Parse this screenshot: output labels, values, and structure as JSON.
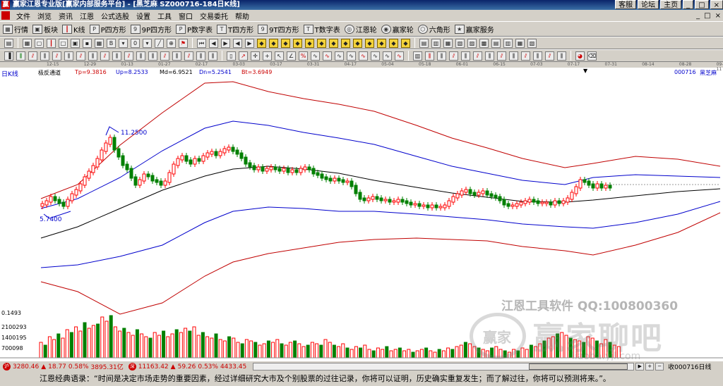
{
  "window": {
    "title": "赢家江恩专业版[赢家内部服务平台] - [黑芝麻   SZ000716-184日K线]",
    "logo_glyph": "赢",
    "buttons": [
      "客服",
      "论坛",
      "主页",
      "_",
      "□",
      "×"
    ]
  },
  "menu": {
    "items": [
      "文件",
      "浏览",
      "资讯",
      "江恩",
      "公式选股",
      "设置",
      "工具",
      "窗口",
      "交易委托",
      "帮助"
    ],
    "right_controls": [
      "_",
      "□",
      "×"
    ]
  },
  "toolbar1": {
    "items": [
      {
        "icon": "grid-icon",
        "label": "行情"
      },
      {
        "icon": "block-icon",
        "label": "板块"
      },
      {
        "icon": "candlestick-icon",
        "label": "K线"
      },
      {
        "icon": "p-square-icon",
        "label": "P四方形"
      },
      {
        "icon": "9p-square-icon",
        "label": "9P四方形"
      },
      {
        "icon": "p-numbers-icon",
        "label": "P数字表"
      },
      {
        "icon": "t-square-icon",
        "label": "T四方形"
      },
      {
        "icon": "9t-square-icon",
        "label": "9T四方形"
      },
      {
        "icon": "t-numbers-icon",
        "label": "T数字表"
      },
      {
        "icon": "gann-wheel-icon",
        "label": "江恩轮"
      },
      {
        "icon": "winner-wheel-icon",
        "label": "赢家轮"
      },
      {
        "icon": "hexagon-icon",
        "label": "六角形"
      },
      {
        "icon": "service-icon",
        "label": "赢家服务"
      }
    ]
  },
  "date_axis": {
    "labels": [
      "12-15",
      "12-29",
      "01-13",
      "01-27",
      "02-17",
      "03-03",
      "03-17",
      "03-31",
      "04-17",
      "05-04",
      "05-18",
      "06-01",
      "06-15",
      "07-03",
      "07-17",
      "07-31",
      "08-14",
      "08-28",
      "09-11"
    ]
  },
  "chart_header": {
    "period_label": "日K线",
    "indicator_name": "极反通道",
    "tp": "Tp=9.3816",
    "up": "Up=8.2533",
    "md": "Md=6.9521",
    "dn": "Dn=5.2541",
    "bt": "Bt=3.6949",
    "stock_code": "000716",
    "stock_name": "黑芝麻"
  },
  "chart_annotations": {
    "high_label": "11.2500",
    "low_label": "5.7400"
  },
  "volume_axis": {
    "labels": [
      "0.1493",
      "2100293",
      "1400195",
      "700098"
    ]
  },
  "watermark": {
    "line1": "江恩工具软件    QQ:100800360",
    "brand_badge": "赢家",
    "brand_big": "赢家聊吧",
    "brand_url": "liaoba.yjl.com"
  },
  "statusbar": {
    "sh_badge": "沪",
    "sh_index": "3280.46",
    "sh_change": "18.77",
    "sh_pct": "0.58%",
    "sh_amount": "3895.31亿",
    "sz_badge": "深",
    "sz_index": "11163.42",
    "sz_change": "59.26",
    "sz_pct": "0.53%",
    "sz_amount": "4433.45",
    "period_tab": "收000716日线"
  },
  "quote": {
    "text": "江恩经典语录：“时间是决定市场走势的重要因素，经过详细研究大市及个别股票的过往记录，你将可以证明，历史确实重复发生；而了解过往，你将可以预测将来。”。"
  },
  "colors": {
    "up_candle": "#ff0000",
    "down_candle": "#008000",
    "outer_band": "#c00000",
    "inner_band": "#0000cc",
    "mid_line": "#000000"
  }
}
